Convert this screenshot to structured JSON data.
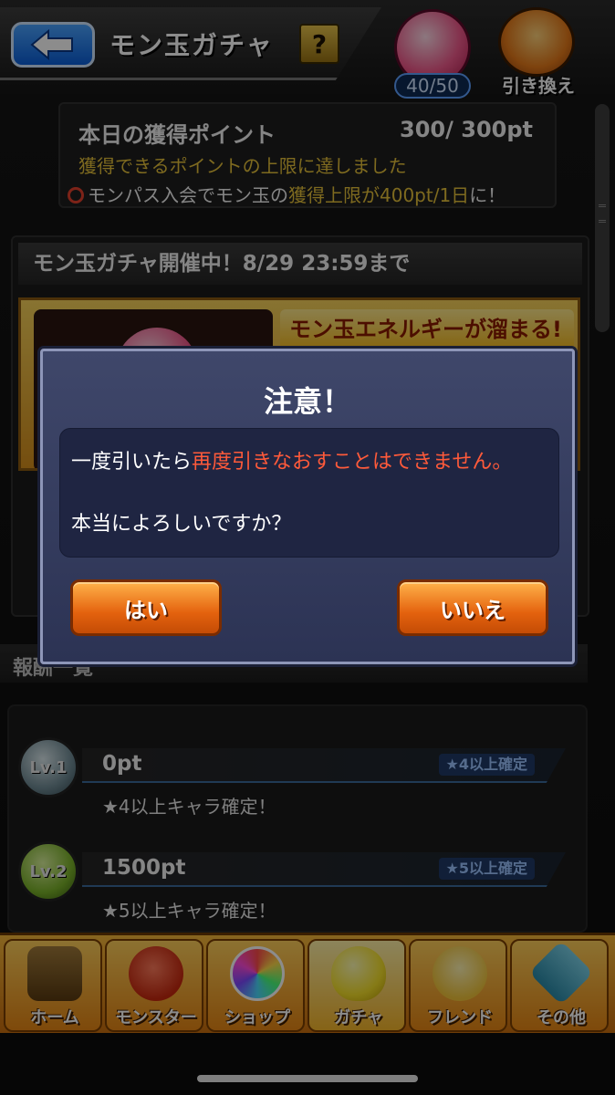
{
  "header": {
    "title": "モン玉ガチャ",
    "help_label": "?",
    "orb_count": "40/50",
    "exchange_label": "引き換え"
  },
  "points": {
    "label": "本日の獲得ポイント",
    "value": "300/ 300pt",
    "limit_message": "獲得できるポイントの上限に達しました",
    "promo_prefix": "モンパス入会でモン玉の",
    "promo_highlight": "獲得上限が400pt/1日",
    "promo_suffix": "に！"
  },
  "event": {
    "title": "モン玉ガチャ開催中！8/29 23:59まで",
    "banner_text": "モン玉エネルギーが溜まる!"
  },
  "rewards": {
    "header": "報酬一覧",
    "items": [
      {
        "level": "Lv.1",
        "points": "0pt",
        "tag": "★4以上確定",
        "description": "★4以上キャラ確定！"
      },
      {
        "level": "Lv.2",
        "points": "1500pt",
        "tag": "★5以上確定",
        "description": "★5以上キャラ確定！"
      }
    ]
  },
  "dialog": {
    "title": "注意！",
    "line1_prefix": "一度引いたら",
    "line1_warning": "再度引きなおすことはできません。",
    "line2": "本当によろしいですか？",
    "yes_label": "はい",
    "no_label": "いいえ"
  },
  "nav": {
    "items": [
      {
        "label": "ホーム",
        "icon": "home-icon"
      },
      {
        "label": "モンスター",
        "icon": "monster-icon"
      },
      {
        "label": "ショップ",
        "icon": "shop-icon"
      },
      {
        "label": "ガチャ",
        "icon": "gacha-icon"
      },
      {
        "label": "フレンド",
        "icon": "friend-icon"
      },
      {
        "label": "その他",
        "icon": "other-icon"
      }
    ],
    "active_index": 3
  },
  "colors": {
    "accent_orange": "#e4620e",
    "warning_red": "#ff5a3a",
    "highlight_yellow": "#e6c13a",
    "dialog_blue": "#2c3354"
  }
}
